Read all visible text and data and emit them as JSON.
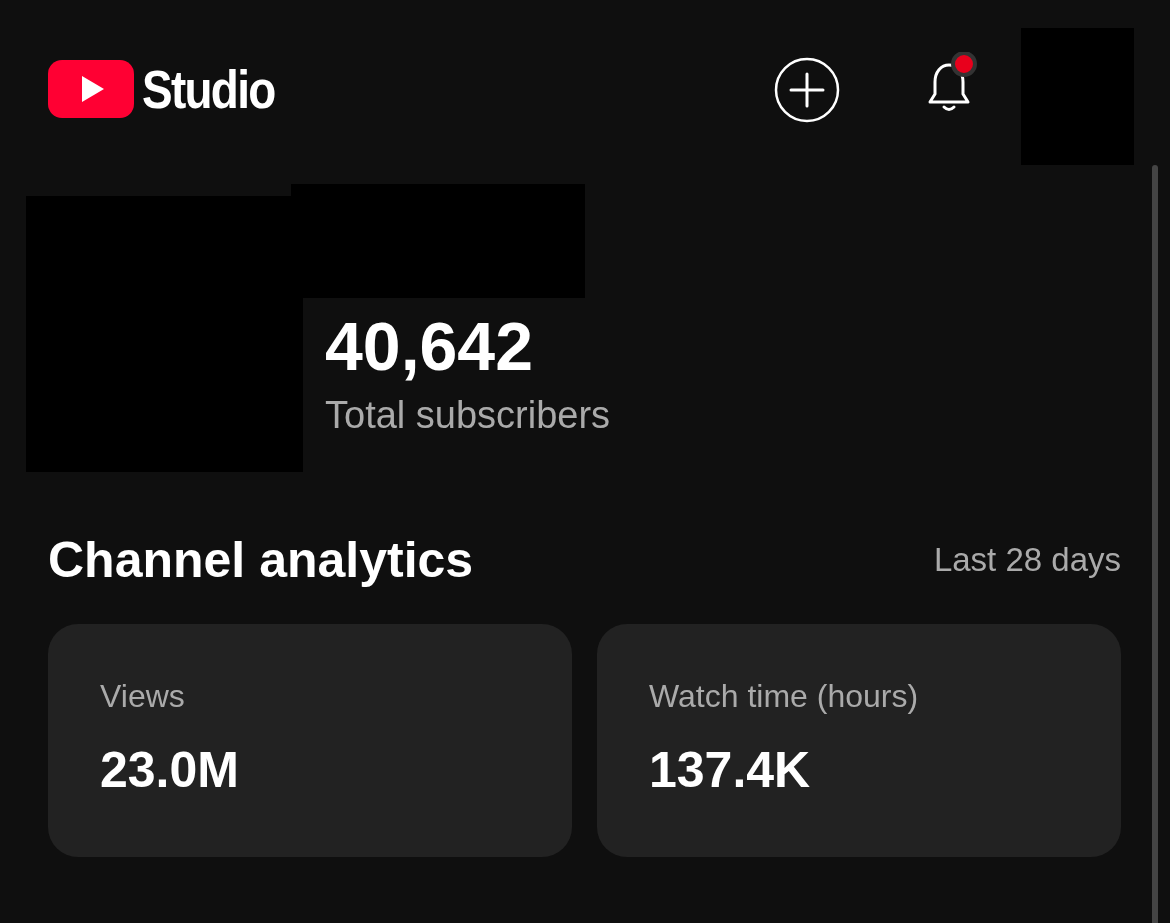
{
  "header": {
    "logo_text": "Studio",
    "notification_dot": true
  },
  "channel": {
    "subscriber_count": "40,642",
    "subscriber_label": "Total subscribers"
  },
  "analytics": {
    "title": "Channel analytics",
    "period": "Last 28 days",
    "cards": [
      {
        "label": "Views",
        "value": "23.0M"
      },
      {
        "label": "Watch time (hours)",
        "value": "137.4K"
      }
    ]
  }
}
